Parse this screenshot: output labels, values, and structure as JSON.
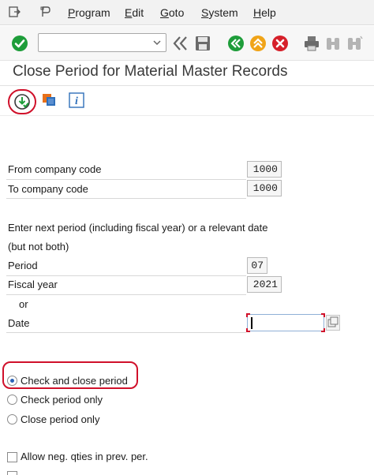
{
  "menu": {
    "items": [
      {
        "label": "Program",
        "underline": "P",
        "rest": "rogram"
      },
      {
        "label": "Edit",
        "underline": "E",
        "rest": "dit"
      },
      {
        "label": "Goto",
        "underline": "G",
        "rest": "oto"
      },
      {
        "label": "System",
        "underline": "S",
        "rest": "ystem"
      },
      {
        "label": "Help",
        "underline": "H",
        "rest": "elp"
      }
    ]
  },
  "toolbar": {
    "command_field_value": "",
    "icons": [
      "enter-icon",
      "back-nav-icon",
      "save-icon",
      "back-icon",
      "exit-icon",
      "cancel-icon",
      "print-icon",
      "find-icon",
      "find-next-icon"
    ]
  },
  "page": {
    "title": "Close Period for Material Master Records"
  },
  "app_toolbar": {
    "icons": [
      "execute-icon",
      "get-variant-icon",
      "program-info-icon"
    ]
  },
  "form": {
    "from_company_code_label": "From company code",
    "from_company_code_value": "1000",
    "to_company_code_label": "To company code",
    "to_company_code_value": "1000",
    "instruction_line1": "Enter next period (including fiscal year) or a relevant date",
    "instruction_line2": "(but not both)",
    "period_label": "Period",
    "period_value": "07",
    "fiscal_year_label": "Fiscal year",
    "fiscal_year_value": "2021",
    "or_label": "or",
    "date_label": "Date",
    "date_value": ""
  },
  "options": {
    "radios": [
      {
        "label": "Check and close period",
        "selected": true
      },
      {
        "label": "Check period only",
        "selected": false
      },
      {
        "label": "Close period only",
        "selected": false
      }
    ],
    "checkboxes": [
      {
        "label": "Allow neg. qties in prev. per.",
        "checked": false
      }
    ]
  },
  "colors": {
    "highlight_red": "#d0102a",
    "enter_green": "#1e9d3a",
    "back_green": "#1e9d3a",
    "exit_orange": "#f0a418",
    "cancel_red": "#d6202a"
  }
}
